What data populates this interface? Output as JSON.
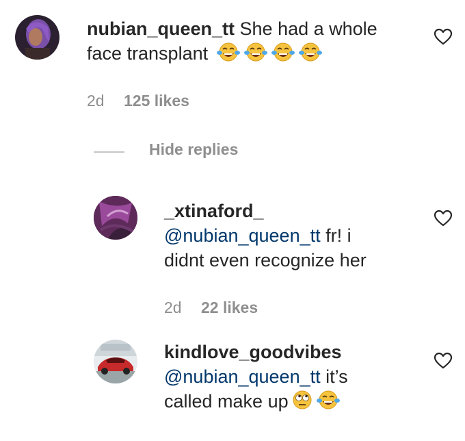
{
  "comments": [
    {
      "username": "nubian_queen_tt",
      "text_line1": "She had a whole",
      "text_line2": "face transplant",
      "emojis": [
        "tears-of-joy",
        "tears-of-joy",
        "tears-of-joy",
        "tears-of-joy"
      ],
      "time": "2d",
      "likes": "125 likes"
    }
  ],
  "replies_toggle": "Hide replies",
  "replies": [
    {
      "username": "_xtinaford_",
      "mention": "@nubian_queen_tt",
      "text_line1": " fr! i",
      "text_line2": "didnt even recognize her",
      "time": "2d",
      "likes": "22 likes"
    },
    {
      "username": "kindlove_goodvibes",
      "mention": "@nubian_queen_tt",
      "text_line1": " it’s",
      "text_line2": "called make up",
      "emojis": [
        "rolling-eyes",
        "tears-of-joy"
      ]
    }
  ],
  "icons": {
    "like": "heart-outline-icon"
  },
  "colors": {
    "text": "#262626",
    "secondary": "#8e8e8e",
    "mention": "#00376b"
  }
}
